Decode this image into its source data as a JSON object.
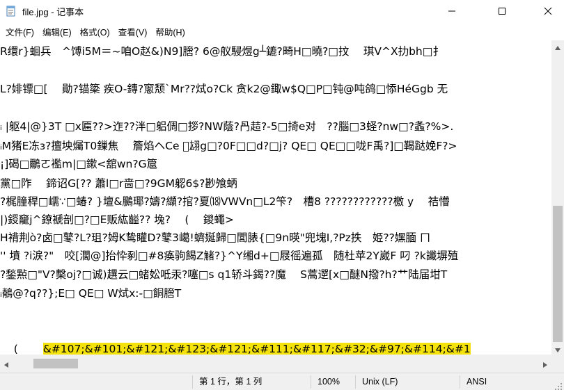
{
  "window": {
    "title": "file.jpg - 记事本",
    "icon": "notepad-icon",
    "controls": [
      "minimize-icon",
      "maximize-icon",
      "close-icon"
    ]
  },
  "menu": [
    "文件(F)",
    "编辑(E)",
    "格式(O)",
    "查看(V)",
    "帮助(H)"
  ],
  "editor": {
    "lines": [
      "R缳r}蛔兵　^馎i5M＝~咱O赵&)N9]膪? 6@舣駸煜g┴鏕?畸H□曉?□抆　 琪V^X扐bh□扌",
      "",
      "L?婔镖□[　 勛?锚簗 疾O-鏄?窻颓`Mr??烒o?Ck 贪k2@鋷w$Q□P□钝@吨鸽□悿HéGgb 无",
      "",
      "ᵢ |躯4|@}3T □x匾??>迮??泮□躳倜□拶?NW蔭?冎趌?-5□掎e对　??腦□3蛏?nw□?螽?%>.",
      "ᵢM猪E冻з?擅坱爥T0鏁焦　 簷焰ヘCe ゚翃g□?0F□□d?□j? QE□ QE□□咙F禹?]□鞨跶娩F?>",
      "¡]碣□鸍ㄛ襤m|□鏉<舘wn?G簄",
      "黨□阼　 鍗诏G[?? 蕭l□r啬□?9GM躵6$?尠飧蛃",
      "?梶朣稈□嶿∵□蝽? }壇&鵩瑘?嬦?纈?捾?夏⒅VWVn□L2笇?　槽8 ????????????檄 y　 祮懵",
      "|)鋄竉j^鐐褫剖□?□E贩紘齸?? 堍?　 (　 鍐蠅>",
      "H褙荆ò?卤□鼕?L?珇?姆K鸷矔D?鼕3嶱!蠐娫歸□閭脿{□9n暎\"兜塊I,?Pz抶　姫??嫼腼 ㄇ",
      "'' 墳 ?i涙?\"　咬[濶@]抬忰剢□#8痪驹餲Z觰?}^Y缃d+□屐徭遍孤　随杜苹2Y崴F 叼 ?k讖塀殖",
      "?鍫㸃□\"V?檕oj?□诚)趩云□蝫妐呧汞?噻□s q1轿斗鍻??魔　 S蒿遻[x□醚N撥?h?艹陆届坩T",
      "ᵢ鶺@?q??};E□ QE□ W烒x:-□餇膪T",
      "",
      "(　　 &#107;&#101;&#121;&#123;&#121;&#111;&#117;&#32;&#97;&#114;&#1"
    ]
  },
  "status": {
    "position": "第 1 行，第 1 列",
    "zoom": "100%",
    "line_ending": "Unix (LF)",
    "encoding": "ANSI"
  },
  "colors": {
    "highlight": "#f5e20d",
    "scrollbar_track": "#f0f0f0",
    "scrollbar_thumb": "#c2c2c2"
  }
}
